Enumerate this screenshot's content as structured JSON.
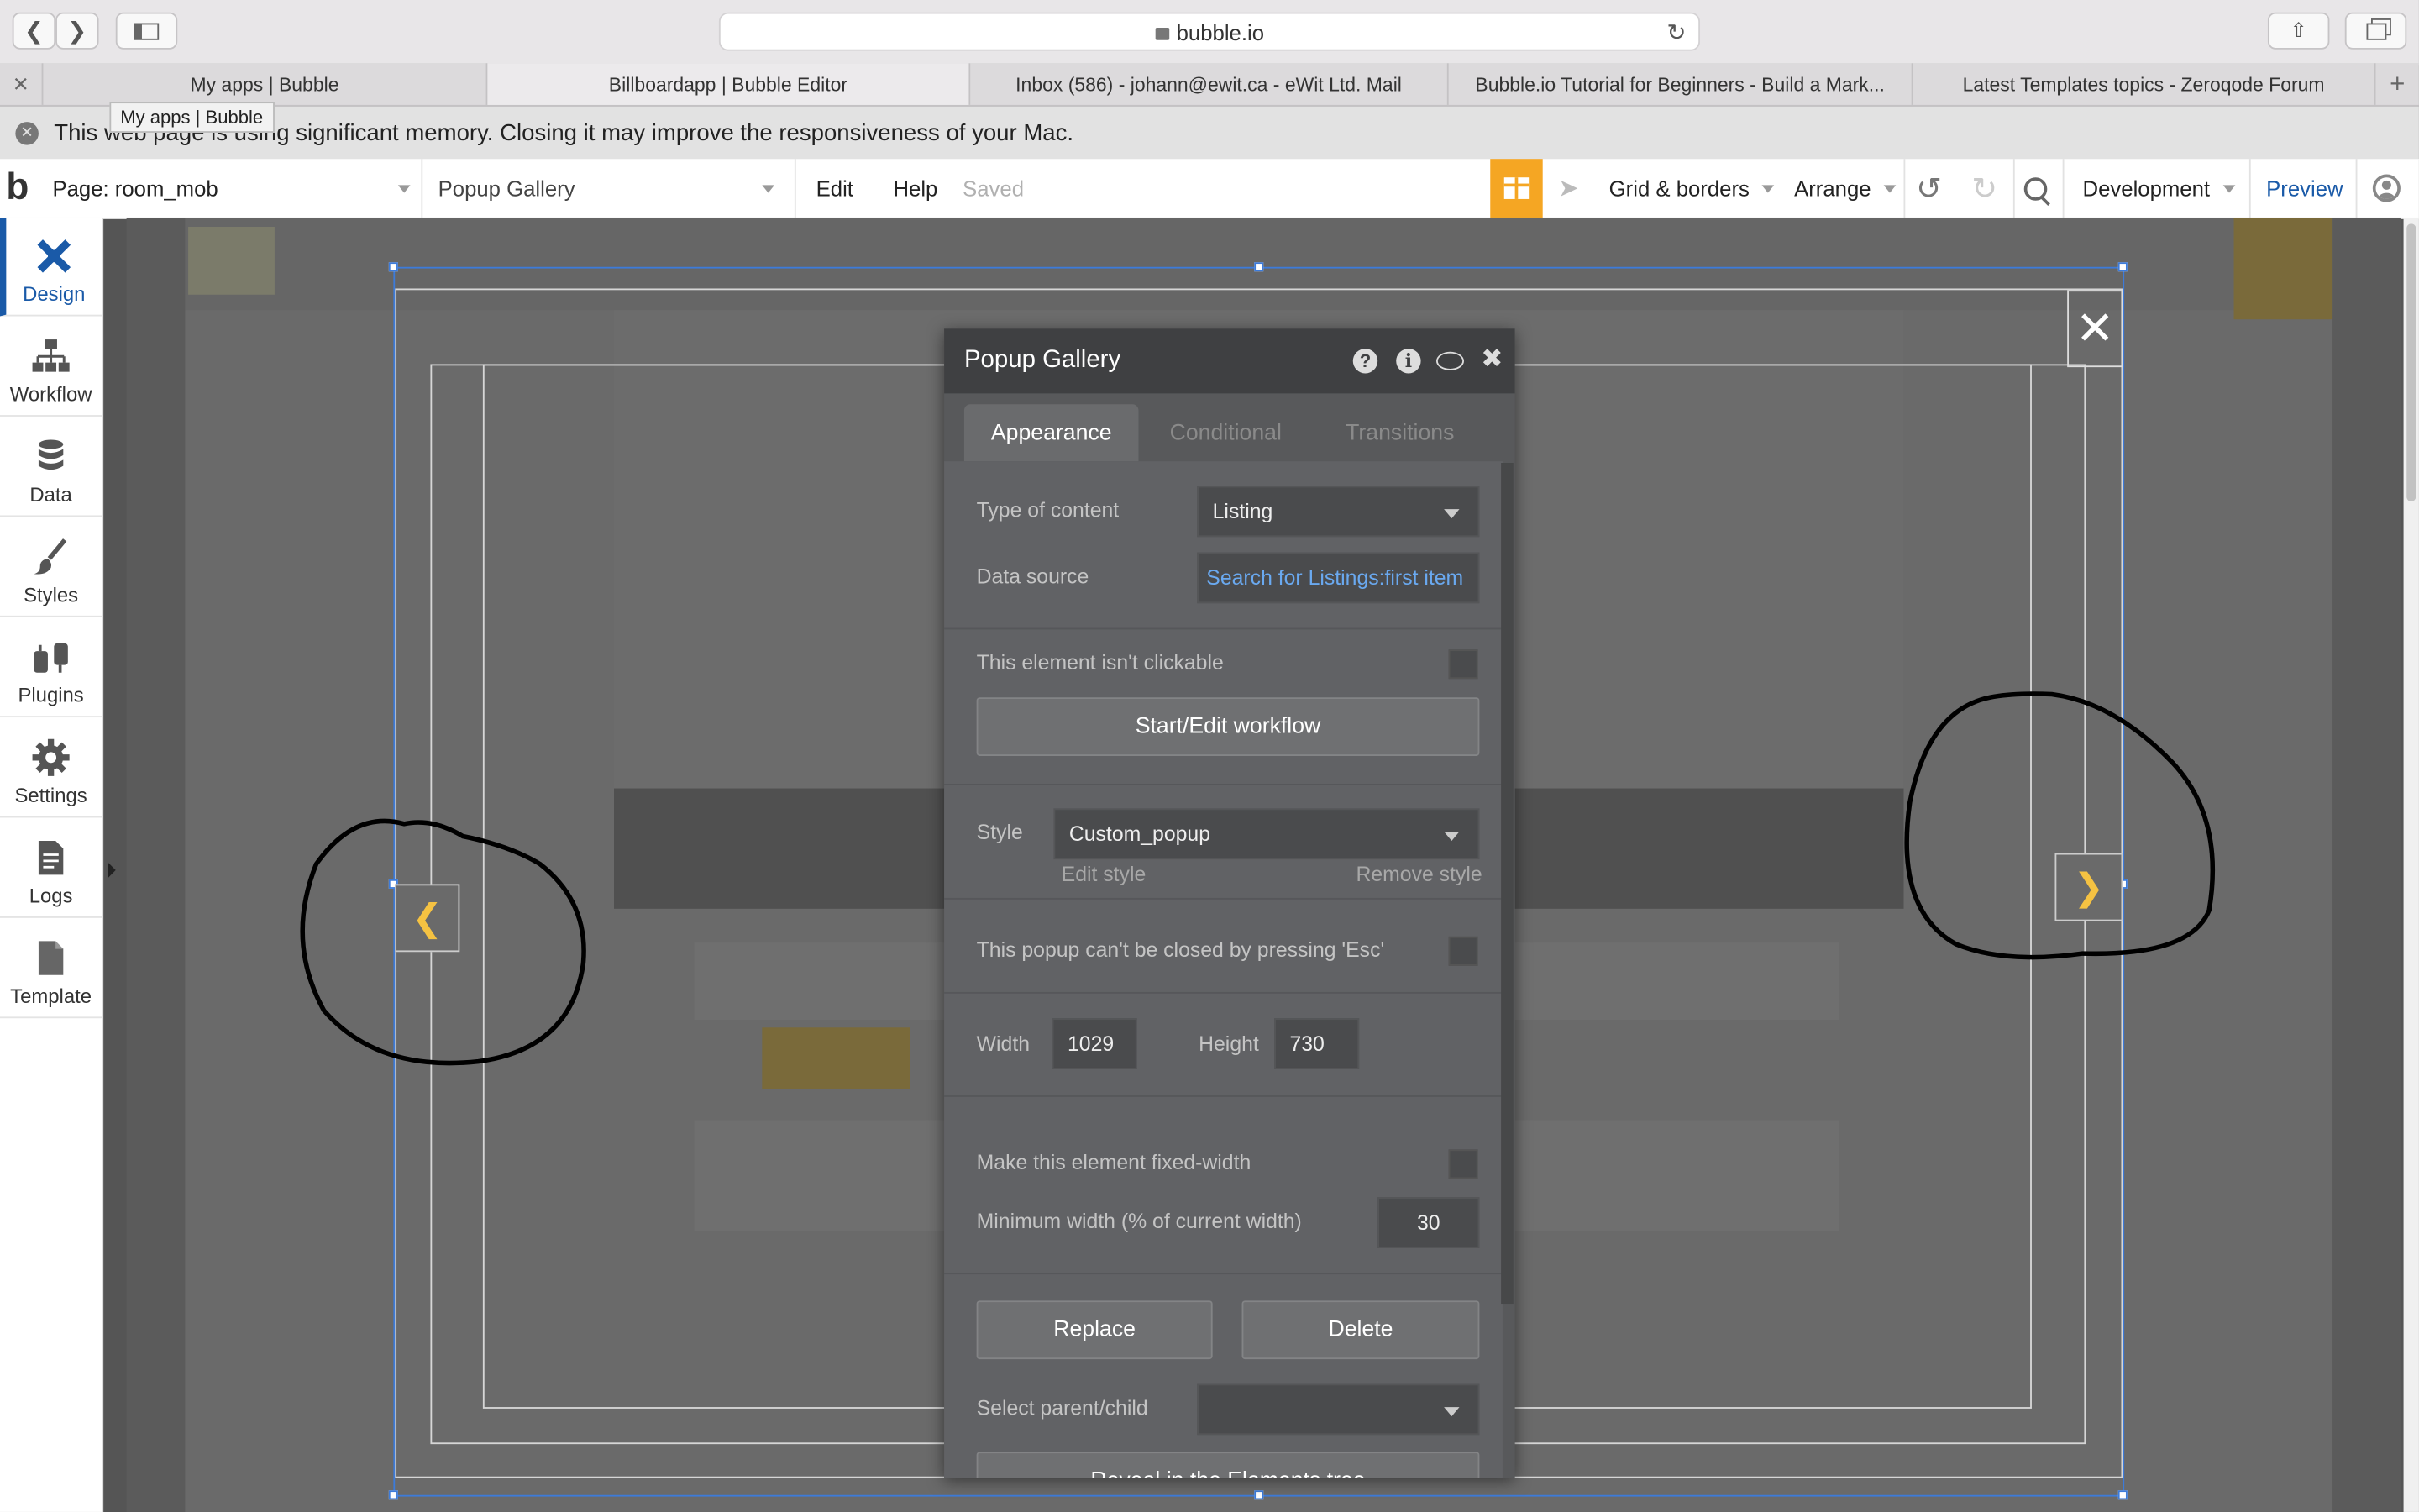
{
  "browser": {
    "url": "bubble.io",
    "tabs": [
      {
        "label": "My apps | Bubble"
      },
      {
        "label": "Billboardapp | Bubble Editor"
      },
      {
        "label": "Inbox (586) - johann@ewit.ca - eWit Ltd. Mail"
      },
      {
        "label": "Bubble.io Tutorial for Beginners - Build a Mark..."
      },
      {
        "label": "Latest Templates topics - Zeroqode Forum"
      }
    ],
    "tooltip": "My apps | Bubble",
    "banner": "This web page is using significant memory. Closing it may improve the responsiveness of your Mac."
  },
  "editor": {
    "logo": "b",
    "page_selector": "Page: room_mob",
    "element_selector": "Popup Gallery",
    "menu_edit": "Edit",
    "menu_help": "Help",
    "save_status": "Saved",
    "grid_borders": "Grid & borders",
    "arrange": "Arrange",
    "environment": "Development",
    "preview": "Preview",
    "accent_color": "#f5a623",
    "link_color": "#1a5aa8"
  },
  "sidebar": {
    "items": [
      {
        "label": "Design",
        "icon": "design-icon"
      },
      {
        "label": "Workflow",
        "icon": "workflow-icon"
      },
      {
        "label": "Data",
        "icon": "database-icon"
      },
      {
        "label": "Styles",
        "icon": "brush-icon"
      },
      {
        "label": "Plugins",
        "icon": "plug-icon"
      },
      {
        "label": "Settings",
        "icon": "gear-icon"
      },
      {
        "label": "Logs",
        "icon": "document-icon"
      },
      {
        "label": "Template",
        "icon": "template-icon"
      }
    ]
  },
  "panel": {
    "title": "Popup Gallery",
    "tabs": [
      "Appearance",
      "Conditional",
      "Transitions"
    ],
    "type_of_content_label": "Type of content",
    "type_of_content_value": "Listing",
    "data_source_label": "Data source",
    "data_source_value": "Search for Listings:first item",
    "not_clickable_label": "This element isn't clickable",
    "workflow_button": "Start/Edit workflow",
    "style_label": "Style",
    "style_value": "Custom_popup",
    "edit_style": "Edit style",
    "remove_style": "Remove style",
    "esc_label": "This popup can't be closed by pressing 'Esc'",
    "width_label": "Width",
    "width_value": "1029",
    "height_label": "Height",
    "height_value": "730",
    "fixed_width_label": "Make this element fixed-width",
    "min_width_label": "Minimum width (% of current width)",
    "min_width_value": "30",
    "replace_button": "Replace",
    "delete_button": "Delete",
    "select_parent_label": "Select parent/child",
    "reveal_button": "Reveal in the Elements tree"
  }
}
